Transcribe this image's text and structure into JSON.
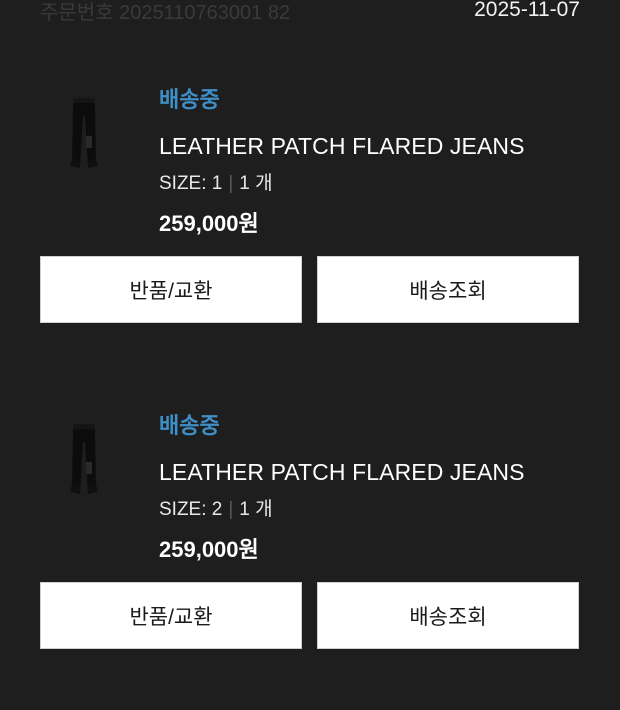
{
  "order": {
    "number_text": "주문번호 2025110763001 82",
    "date": "2025-11-07"
  },
  "items": [
    {
      "status": "배송중",
      "name": "LEATHER PATCH FLARED JEANS",
      "size_label": "SIZE: 1",
      "quantity": "1 개",
      "price": "259,000원",
      "return_label": "반품/교환",
      "track_label": "배송조회"
    },
    {
      "status": "배송중",
      "name": "LEATHER PATCH FLARED JEANS",
      "size_label": "SIZE: 2",
      "quantity": "1 개",
      "price": "259,000원",
      "return_label": "반품/교환",
      "track_label": "배송조회"
    }
  ],
  "colors": {
    "background": "#1e1e1e",
    "status": "#3e8fc7",
    "button_bg": "#ffffff"
  },
  "icons": {
    "product_thumbnail": "jeans-thumbnail-icon"
  }
}
